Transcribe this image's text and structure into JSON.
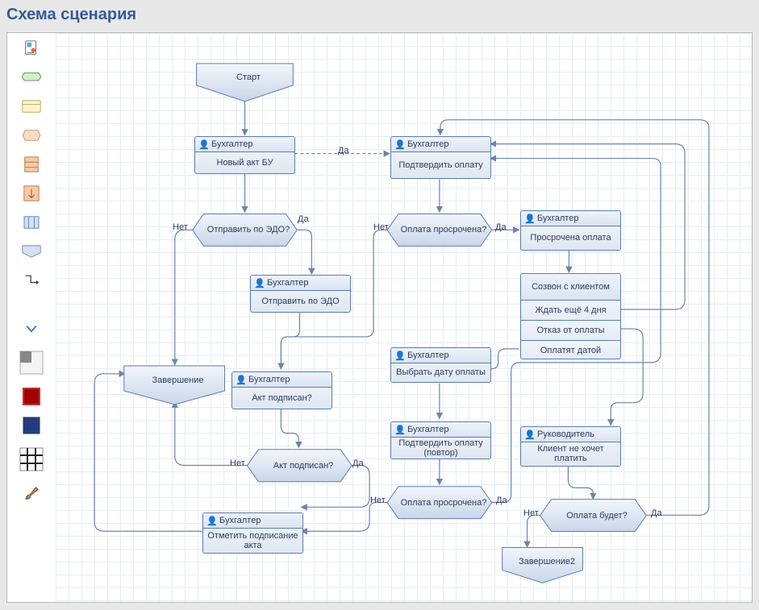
{
  "title": "Схема сценария",
  "labels": {
    "yes": "Да",
    "no": "Нет"
  },
  "palette": [
    {
      "id": "tool-imgdoc",
      "name": "image-doc-icon"
    },
    {
      "id": "tool-start",
      "name": "start-shape-icon"
    },
    {
      "id": "tool-task",
      "name": "task-shape-icon"
    },
    {
      "id": "tool-hex",
      "name": "decision-shape-icon"
    },
    {
      "id": "tool-stack",
      "name": "stack-shape-icon"
    },
    {
      "id": "tool-sub",
      "name": "subprocess-shape-icon"
    },
    {
      "id": "tool-multi",
      "name": "multistate-shape-icon"
    },
    {
      "id": "tool-end",
      "name": "end-shape-icon"
    },
    {
      "id": "tool-conn",
      "name": "connector-icon"
    },
    {
      "id": "tool-toggle",
      "name": "chevron-down-icon"
    },
    {
      "id": "tool-bg",
      "name": "background-icon"
    },
    {
      "id": "tool-fillred",
      "name": "fill-red-icon"
    },
    {
      "id": "tool-fillblue",
      "name": "fill-blue-icon"
    },
    {
      "id": "tool-grid",
      "name": "grid-icon"
    },
    {
      "id": "tool-brush",
      "name": "brush-icon"
    }
  ],
  "roles": {
    "buh": "Бухгалтер",
    "ruk": "Руководитель"
  },
  "nodes": {
    "start": {
      "text": "Старт"
    },
    "end1": {
      "text": "Завершение"
    },
    "end2": {
      "text": "Завершение2"
    },
    "new_act": {
      "role": "buh",
      "text": "Новый акт БУ"
    },
    "confirm_pay": {
      "role": "buh",
      "text": "Подтвердить оплату"
    },
    "send_edo_q": {
      "text": "Отправить по ЭДО?"
    },
    "pay_overdue_q": {
      "text": "Оплата просрочена?"
    },
    "pay_overdue2_q": {
      "text": "Оплата просрочена?"
    },
    "overdue_task": {
      "role": "buh",
      "text": "Просрочена оплата"
    },
    "send_edo": {
      "role": "buh",
      "text": "Отправить по ЭДО"
    },
    "call_client": {
      "title": "Созвон с клиентом",
      "opts": [
        "Ждать ещё 4 дня",
        "Отказ от оплаты",
        "Оплатят датой"
      ]
    },
    "act_signed": {
      "role": "buh",
      "text": "Акт подписан?"
    },
    "act_signed_q": {
      "text": "Акт подписан?"
    },
    "choose_date": {
      "text": "Выбрать дату оплаты"
    },
    "confirm_pay2": {
      "role": "buh",
      "text": "Подтвердить оплату (повтор)"
    },
    "mark_sign": {
      "role": "buh",
      "text": "Отметить подписание акта"
    },
    "no_pay": {
      "role": "ruk",
      "text": "Клиент не хочет платить"
    },
    "pay_willbe_q": {
      "text": "Оплата будет?"
    }
  },
  "colors": {
    "stroke": "#5a7db0",
    "bg1": "#f6f8fb",
    "bg2": "#dfe7f2",
    "edge": "#6d84a8"
  }
}
